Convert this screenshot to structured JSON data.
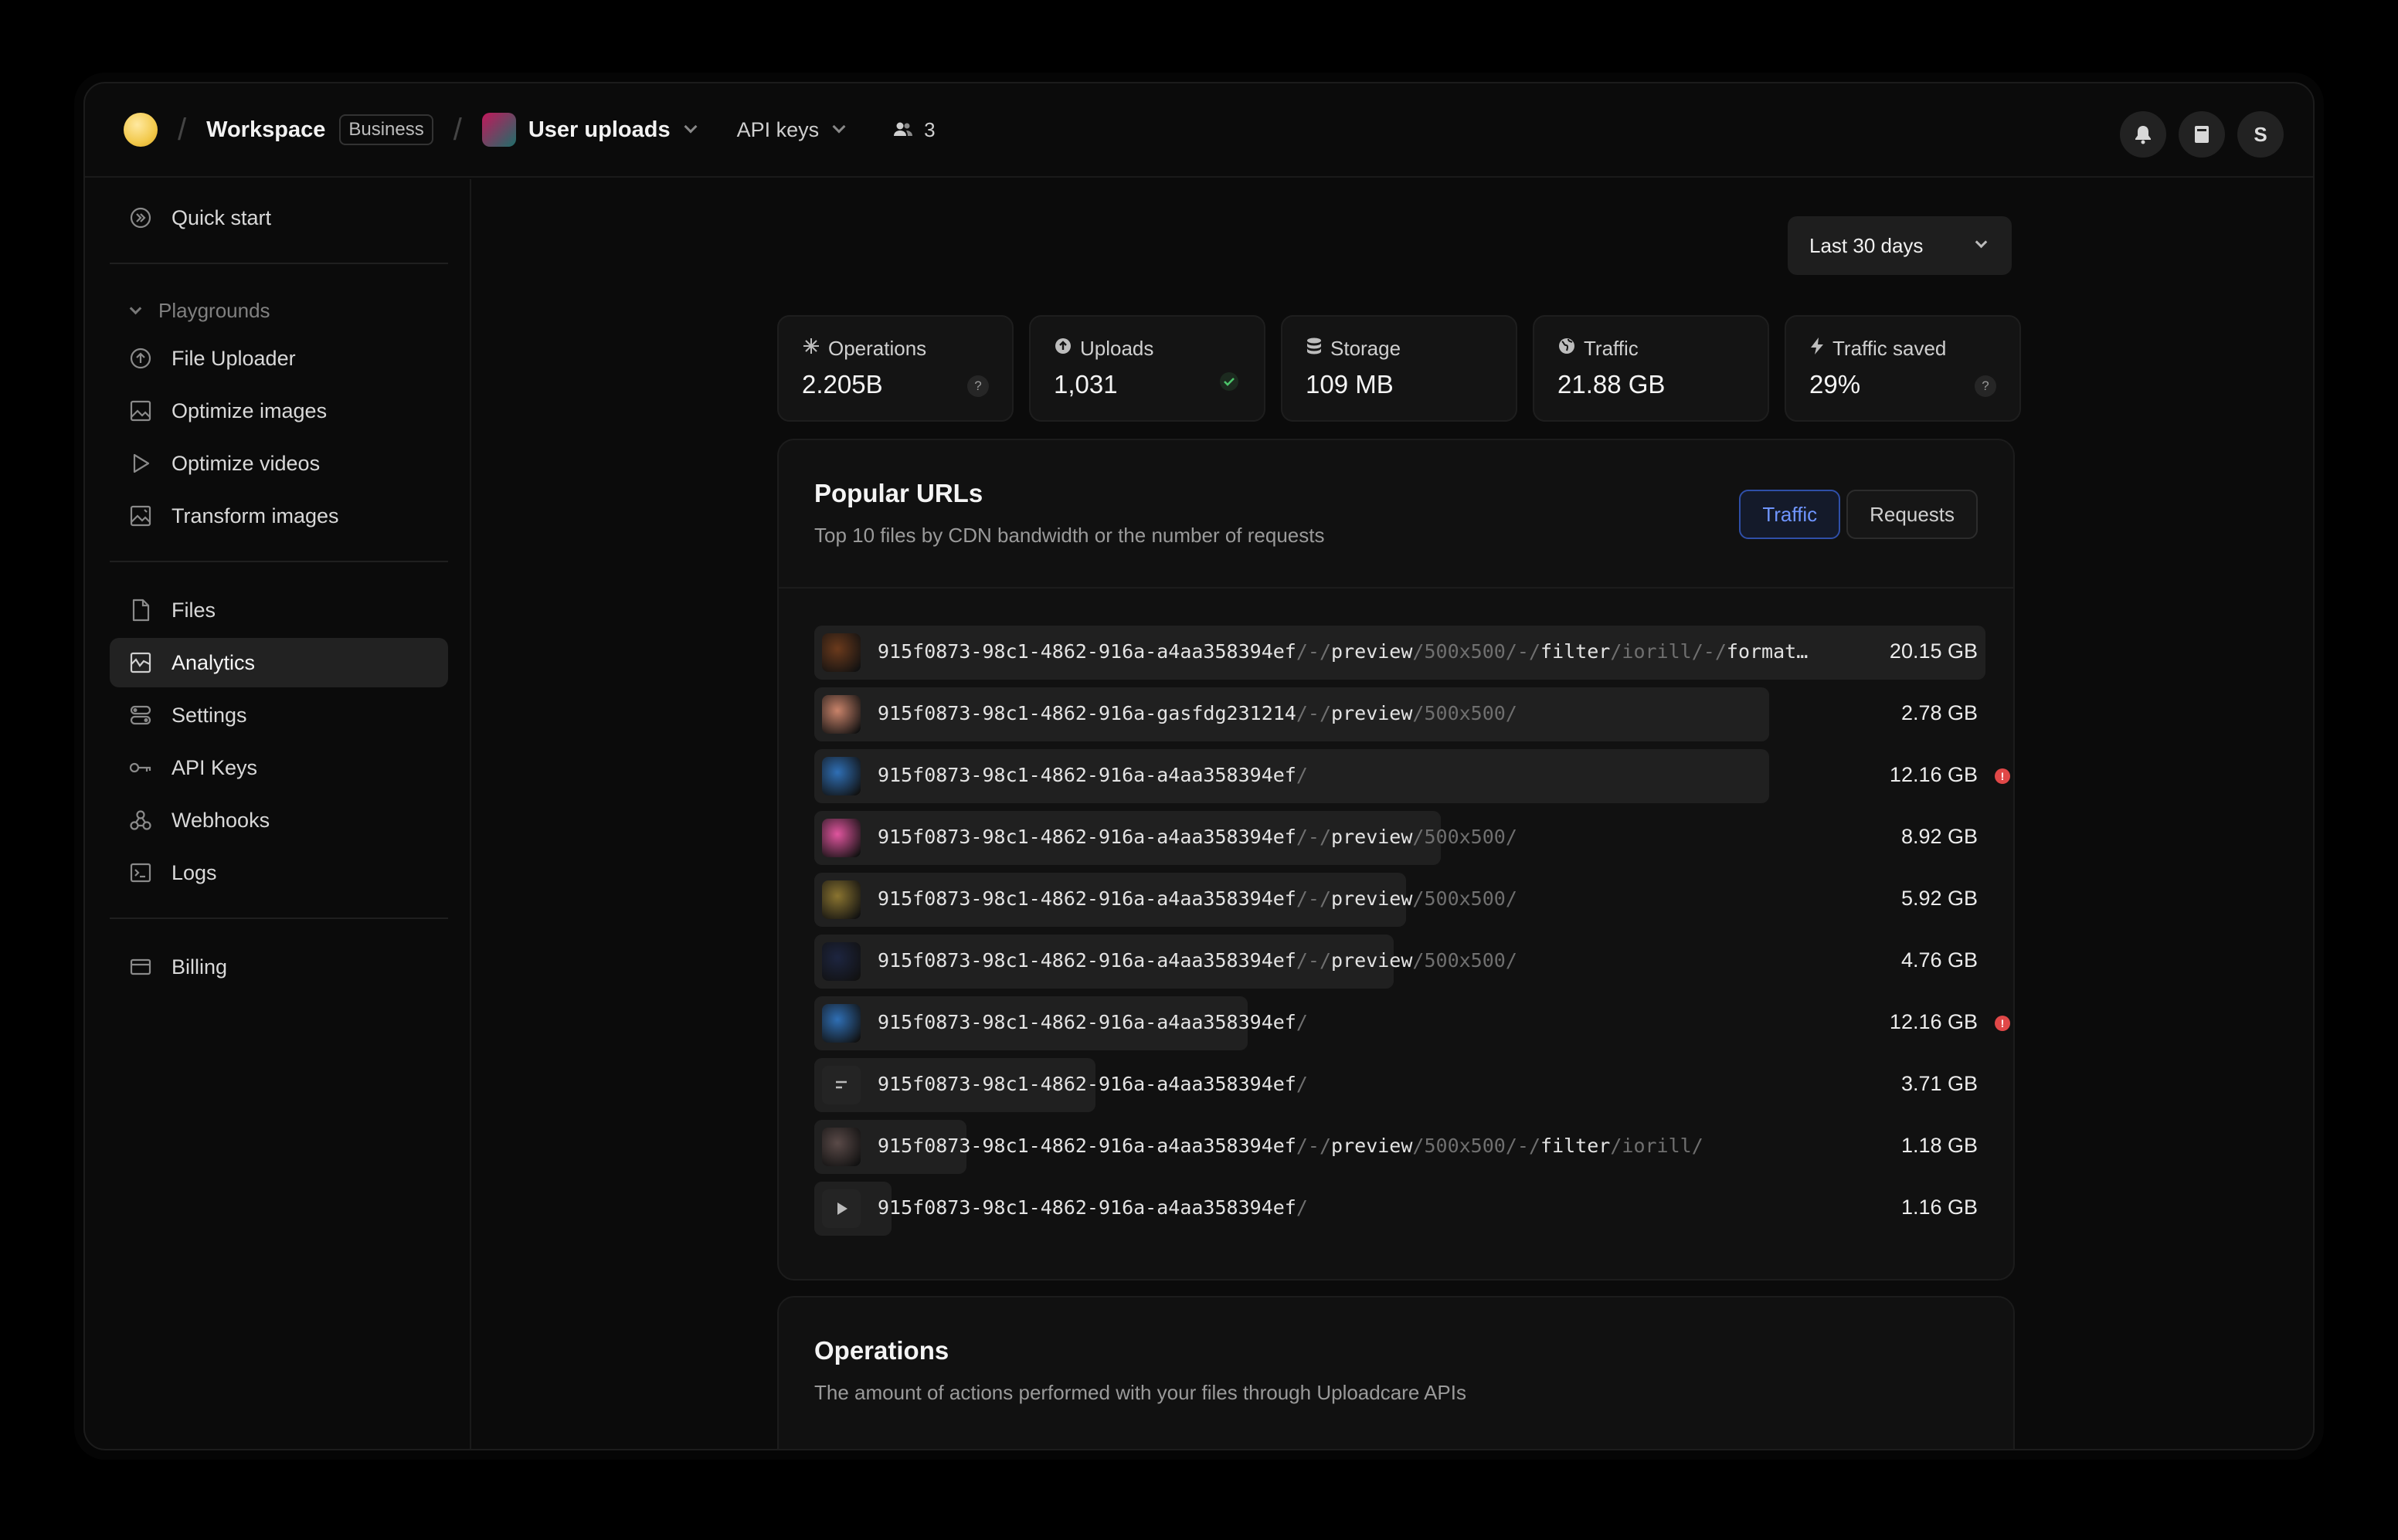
{
  "header": {
    "workspace": "Workspace",
    "plan_badge": "Business",
    "project": "User uploads",
    "api_keys": "API keys",
    "members_count": "3",
    "avatar_initial": "S"
  },
  "sidebar": {
    "quick_start": "Quick start",
    "group_label": "Playgrounds",
    "playgrounds": [
      "File Uploader",
      "Optimize images",
      "Optimize videos",
      "Transform images"
    ],
    "main_items": [
      "Files",
      "Analytics",
      "Settings",
      "API Keys",
      "Webhooks",
      "Logs"
    ],
    "billing": "Billing",
    "active_item": "Analytics"
  },
  "date_range": {
    "selected": "Last 30 days"
  },
  "stats": [
    {
      "label": "Operations",
      "value": "2.205B",
      "icon": "sparkle-icon"
    },
    {
      "label": "Uploads",
      "value": "1,031",
      "icon": "upload-icon"
    },
    {
      "label": "Storage",
      "value": "109 MB",
      "icon": "database-icon"
    },
    {
      "label": "Traffic",
      "value": "21.88 GB",
      "icon": "globe-icon"
    },
    {
      "label": "Traffic saved",
      "value": "29%",
      "icon": "bolt-icon"
    }
  ],
  "popular_urls": {
    "title": "Popular URLs",
    "subtitle": "Top 10 files by CDN bandwidth or the number of requests",
    "toggle": [
      "Traffic",
      "Requests"
    ],
    "rows": [
      {
        "uuid": "915f0873-98c1-4862-916a-a4aa358394ef",
        "ops": "/-/preview/500x500/-/filter/iorill/-/format…",
        "size": "20.15 GB",
        "bar": 1.0,
        "warn": false,
        "thumb": "#6b3a1c"
      },
      {
        "uuid": "915f0873-98c1-4862-916a-gasfdg231214",
        "ops": "/-/preview/500x500/",
        "size": "2.78 GB",
        "bar": 0.815,
        "warn": false,
        "thumb": "#c9836a"
      },
      {
        "uuid": "915f0873-98c1-4862-916a-a4aa358394ef",
        "ops": "/",
        "size": "12.16 GB",
        "bar": 0.815,
        "warn": true,
        "thumb": "#2f6fb5"
      },
      {
        "uuid": "915f0873-98c1-4862-916a-a4aa358394ef",
        "ops": "/-/preview/500x500/",
        "size": "8.92 GB",
        "bar": 0.535,
        "warn": false,
        "thumb": "#e0559e"
      },
      {
        "uuid": "915f0873-98c1-4862-916a-a4aa358394ef",
        "ops": "/-/preview/500x500/",
        "size": "5.92 GB",
        "bar": 0.505,
        "warn": false,
        "thumb": "#8a7430"
      },
      {
        "uuid": "915f0873-98c1-4862-916a-a4aa358394ef",
        "ops": "/-/preview/500x500/",
        "size": "4.76 GB",
        "bar": 0.495,
        "warn": false,
        "thumb": "#1d2540"
      },
      {
        "uuid": "915f0873-98c1-4862-916a-a4aa358394ef",
        "ops": "/",
        "size": "12.16 GB",
        "bar": 0.37,
        "warn": true,
        "thumb": "#2f6fb5"
      },
      {
        "uuid": "915f0873-98c1-4862-916a-a4aa358394ef",
        "ops": "/",
        "size": "3.71 GB",
        "bar": 0.24,
        "warn": false,
        "thumb": "doc"
      },
      {
        "uuid": "915f0873-98c1-4862-916a-a4aa358394ef",
        "ops": "/-/preview/500x500/-/filter/iorill/",
        "size": "1.18 GB",
        "bar": 0.13,
        "warn": false,
        "thumb": "#5a4a48"
      },
      {
        "uuid": "915f0873-98c1-4862-916a-a4aa358394ef",
        "ops": "/",
        "size": "1.16 GB",
        "bar": 0.066,
        "warn": false,
        "thumb": "video"
      }
    ]
  },
  "operations": {
    "title": "Operations",
    "subtitle": "The amount of actions performed with your files through Uploadcare APIs"
  }
}
